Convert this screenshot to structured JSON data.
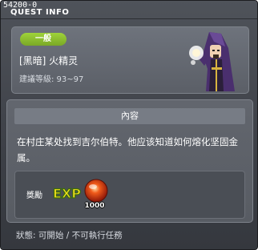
{
  "window": {
    "quest_id": "54200-0",
    "title": "QUEST INFO"
  },
  "header": {
    "category": "一般",
    "quest_name": "[黑暗] 火精灵",
    "level_range": "建議等級: 93~97",
    "npc_icon": "dark-wizard-npc-portrait"
  },
  "content": {
    "section_title": "內容",
    "description": "在村庄某处找到吉尔伯特。他应该知道如何熔化坚固金属。"
  },
  "reward": {
    "label": "獎勵",
    "exp_icon": "exp-icon",
    "amount": "1000"
  },
  "status": {
    "text": "狀態: 可開始 / 不可執行任務"
  },
  "colors": {
    "badge_green": "#8cc232",
    "window_bg": "#43464d"
  }
}
